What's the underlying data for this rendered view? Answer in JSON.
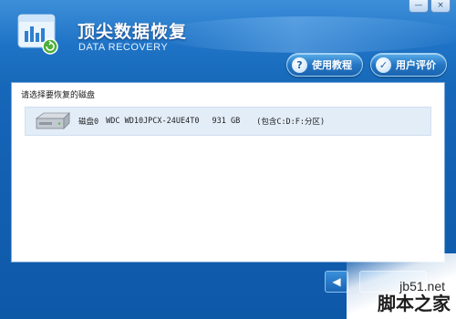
{
  "window": {
    "title": "顶尖数据恢复",
    "subtitle": "DATA RECOVERY",
    "controls": {
      "minimize": "—",
      "close": "×"
    }
  },
  "header": {
    "help_button": {
      "icon": "question-circle-icon",
      "glyph": "?",
      "label": "使用教程"
    },
    "review_button": {
      "icon": "thumbs-up-icon",
      "glyph": "✓",
      "label": "用户评价"
    }
  },
  "panel": {
    "title": "请选择要恢复的磁盘",
    "disks": [
      {
        "icon": "hard-drive-icon",
        "name": "磁盘0",
        "model": "WDC WD10JPCX-24UE4T0",
        "size": "931 GB",
        "partitions": "(包含C:D:F:分区)"
      }
    ]
  },
  "footer": {
    "prev_icon": "arrow-left-icon",
    "prev_glyph": "◀"
  },
  "watermark": {
    "url": "jb51.net",
    "name": "脚本之家"
  },
  "colors": {
    "header": "#1f73c6",
    "panel_border": "#7ea9d6",
    "row_highlight": "#e3edf8"
  }
}
